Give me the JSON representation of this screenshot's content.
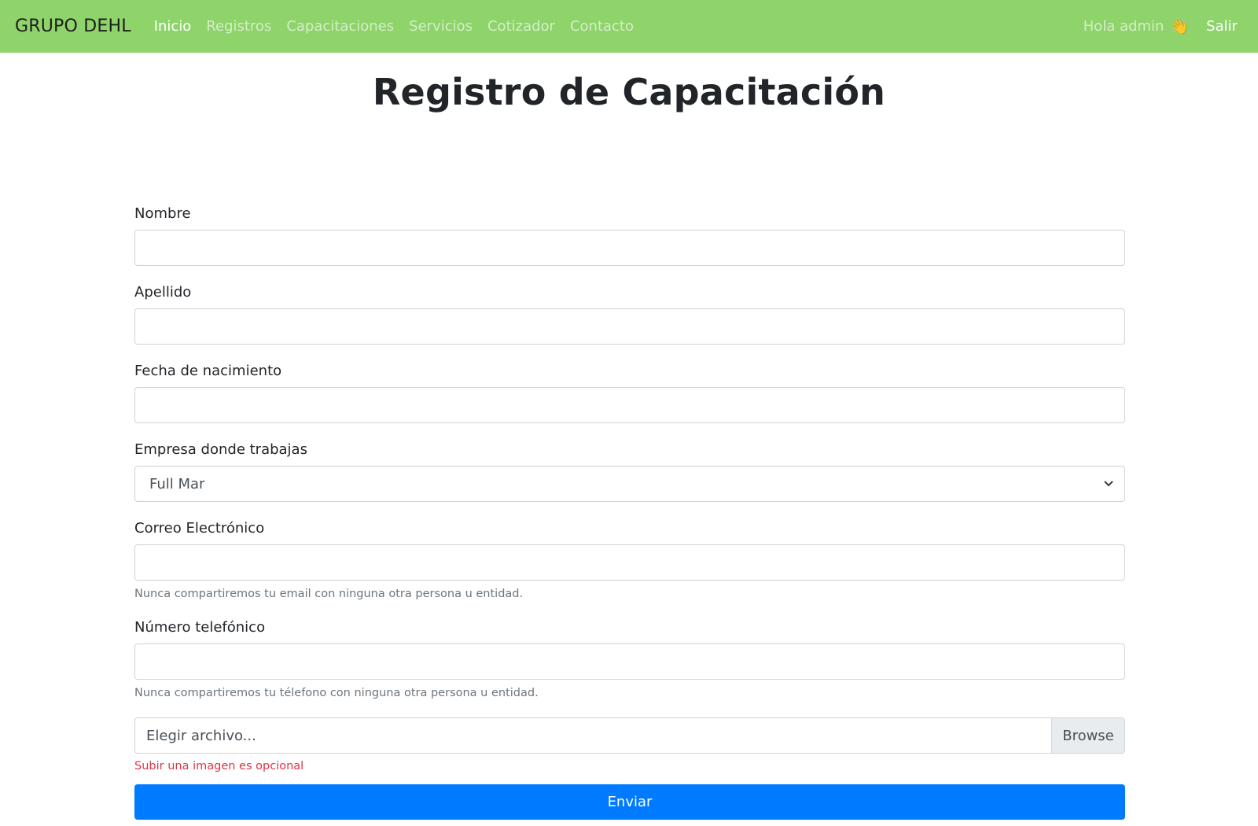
{
  "navbar": {
    "brand": "GRUPO DEHL",
    "links": [
      "Inicio",
      "Registros",
      "Capacitaciones",
      "Servicios",
      "Cotizador",
      "Contacto"
    ],
    "active_link": "Inicio",
    "greeting": "Hola admin",
    "greeting_icon": "waving-hand-icon",
    "logout": "Salir",
    "background_color": "#8fd36b"
  },
  "page": {
    "title": "Registro de Capacitación"
  },
  "form": {
    "nombre_label": "Nombre",
    "nombre_value": "",
    "apellido_label": "Apellido",
    "apellido_value": "",
    "fecha_label": "Fecha de nacimiento",
    "fecha_value": "",
    "empresa_label": "Empresa donde trabajas",
    "empresa_selected": "Full Mar",
    "correo_label": "Correo Electrónico",
    "correo_value": "",
    "correo_help": "Nunca compartiremos tu email con ninguna otra persona u entidad.",
    "telefono_label": "Número telefónico",
    "telefono_value": "",
    "telefono_help": "Nunca compartiremos tu télefono con ninguna otra persona u entidad.",
    "file_placeholder": "Elegir archivo...",
    "browse_label": "Browse",
    "file_optional_note": "Subir una imagen es opcional",
    "submit_label": "Enviar",
    "submit_color": "#007bff"
  }
}
